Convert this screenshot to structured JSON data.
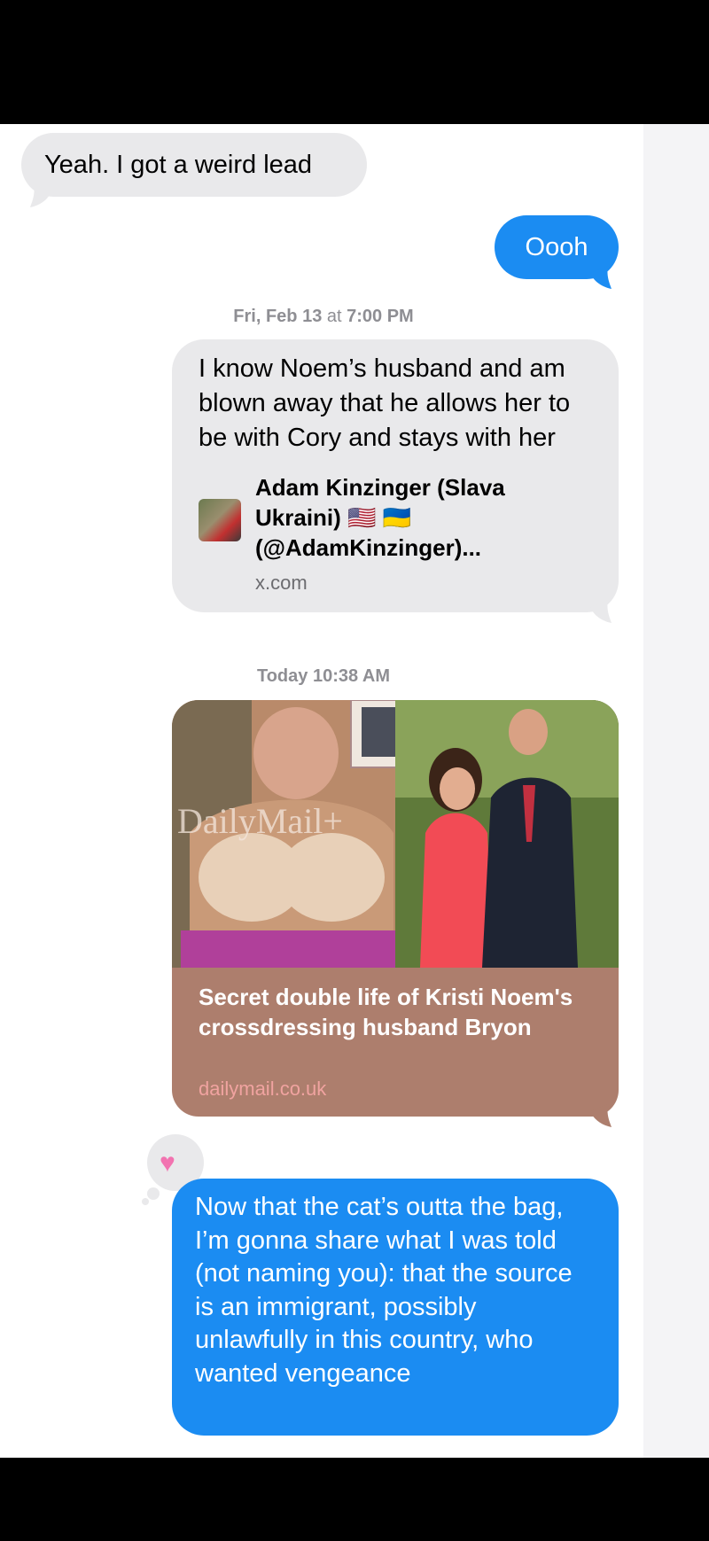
{
  "messages": {
    "incoming_1": "Yeah. I got a weird lead",
    "outgoing_1": "Oooh",
    "timestamp_1_day": "Fri, Feb 13",
    "timestamp_1_at": " at ",
    "timestamp_1_time": "7:00 PM",
    "outgoing_2": "I know Noem’s husband and am blown away that he allows her to be with Cory and stays with her",
    "link_1_title": "Adam Kinzinger (Slava Ukraini) 🇺🇸 🇺🇦 (@AdamKinzinger)...",
    "link_1_host": "x.com",
    "timestamp_2_day": "Today",
    "timestamp_2_time": "10:38 AM",
    "link_2_watermark": "DailyMail+",
    "link_2_title": "Secret double life of Kristi Noem's crossdressing husband Bryon",
    "link_2_host": "dailymail.co.uk",
    "tapback": "heart",
    "outgoing_3": "Now that the cat’s outta the bag, I’m gonna share what I was told (not naming you): that the source is an immigrant, possibly unlawfully in this country, who wanted vengeance"
  },
  "colors": {
    "gray_bubble": "#e9e9eb",
    "blue_bubble": "#1b8cf2",
    "link_card": "#ad7e6d",
    "tapback_heart": "#f273b0"
  }
}
